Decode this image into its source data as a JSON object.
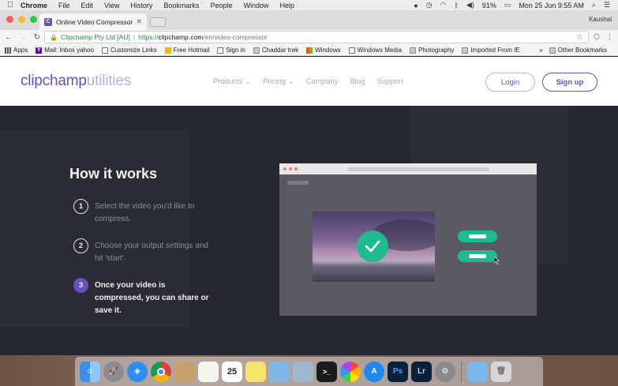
{
  "menubar": {
    "app": "Chrome",
    "items": [
      "File",
      "Edit",
      "View",
      "History",
      "Bookmarks",
      "People",
      "Window",
      "Help"
    ],
    "battery": "91%",
    "clock": "Mon 25 Jun  9:55 AM"
  },
  "browser": {
    "tab_title": "Online Video Compressor, free",
    "profile": "Kaushal",
    "omnibox": {
      "org": "Clipchamp Pty Ltd [AU]",
      "sep": "|",
      "scheme": "https://",
      "host": "clipchamp.com",
      "path": "/en/video-compressor"
    },
    "bookmarks": [
      {
        "label": "Apps",
        "icon": "apps-grid-icon"
      },
      {
        "label": "Mail: Inbox yahoo",
        "icon": "yahoo-icon"
      },
      {
        "label": "Customize Links",
        "icon": "page-icon"
      },
      {
        "label": "Free Hotmail",
        "icon": "hotmail-icon"
      },
      {
        "label": "Sign in",
        "icon": "page-icon"
      },
      {
        "label": "Chaddar trek",
        "icon": "folder-icon"
      },
      {
        "label": "Windows",
        "icon": "windows-icon"
      },
      {
        "label": "Windows Media",
        "icon": "page-icon"
      },
      {
        "label": "Photography",
        "icon": "folder-icon"
      },
      {
        "label": "Imported From IE",
        "icon": "folder-icon"
      }
    ],
    "bookmarks_more": "»",
    "other_bookmarks": "Other Bookmarks"
  },
  "site": {
    "logo_main": "clipchamp",
    "logo_sub": "utilities",
    "nav": [
      {
        "label": "Products",
        "chevron": true
      },
      {
        "label": "Pricing",
        "chevron": true
      },
      {
        "label": "Company",
        "chevron": false
      },
      {
        "label": "Blog",
        "chevron": false
      },
      {
        "label": "Support",
        "chevron": false
      }
    ],
    "login_label": "Login",
    "signup_label": "Sign up",
    "accent": "#6b4fbb"
  },
  "hero": {
    "title": "How it works",
    "steps": [
      {
        "num": "1",
        "text": "Select the video you'd like to compress."
      },
      {
        "num": "2",
        "text": "Choose your output settings and hit 'start'."
      },
      {
        "num": "3",
        "text": "Once your video is compressed, you can share or save it."
      }
    ],
    "check_color": "#1fbb8f"
  },
  "dock": {
    "calendar_day": "25",
    "apps": [
      "finder-icon",
      "launchpad-icon",
      "safari-icon",
      "chrome-icon",
      "notes-icon",
      "textedit-icon",
      "calendar-icon",
      "stickies-icon",
      "preview-icon",
      "photos-icon",
      "terminal-icon",
      "photos-flower-icon",
      "appstore-icon",
      "photoshop-icon",
      "lightroom-icon",
      "system-prefs-icon",
      "downloads-folder-icon",
      "trash-icon"
    ],
    "ps_label": "Ps",
    "lr_label": "Lr"
  }
}
